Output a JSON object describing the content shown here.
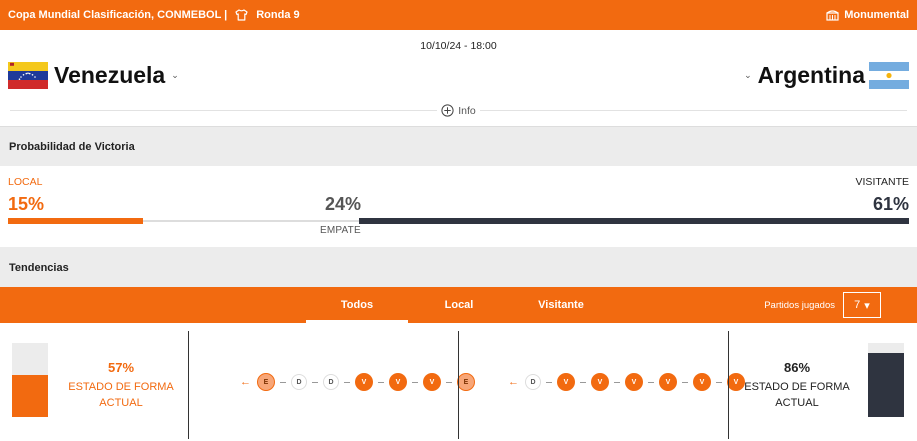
{
  "header": {
    "competition": "Copa Mundial Clasificación, CONMEBOL |",
    "round": "Ronda 9",
    "stadium": "Monumental",
    "icons": {
      "round": "jersey-icon",
      "stadium": "stadium-icon"
    }
  },
  "match": {
    "datetime": "10/10/24 - 18:00",
    "home": {
      "name": "Venezuela",
      "caret": "⌄"
    },
    "away": {
      "name": "Argentina",
      "caret": "⌄"
    },
    "info_label": "Info"
  },
  "probability": {
    "title": "Probabilidad de Victoria",
    "local_label": "LOCAL",
    "away_label": "VISITANTE",
    "local_pct": "15%",
    "draw_pct": "24%",
    "away_pct": "61%",
    "draw_label": "EMPATE",
    "local_value": 15,
    "draw_value": 24,
    "away_value": 61
  },
  "trends": {
    "title": "Tendencias",
    "tabs": [
      {
        "label": "Todos",
        "active": true
      },
      {
        "label": "Local",
        "active": false
      },
      {
        "label": "Visitante",
        "active": false
      }
    ],
    "played_label": "Partidos jugados",
    "played_value": "7",
    "home_form": {
      "pct": "57%",
      "line1": "ESTADO DE FORMA",
      "line2": "ACTUAL",
      "value": 57
    },
    "away_form": {
      "pct": "86%",
      "line1": "ESTADO DE FORMA",
      "line2": "ACTUAL",
      "value": 86
    },
    "home_sequence": [
      "E",
      "D",
      "D",
      "V",
      "V",
      "V",
      "E"
    ],
    "away_sequence": [
      "D",
      "V",
      "V",
      "V",
      "V",
      "V",
      "V"
    ],
    "colors": {
      "accent": "#f26a10",
      "dark": "#2f3440"
    }
  }
}
